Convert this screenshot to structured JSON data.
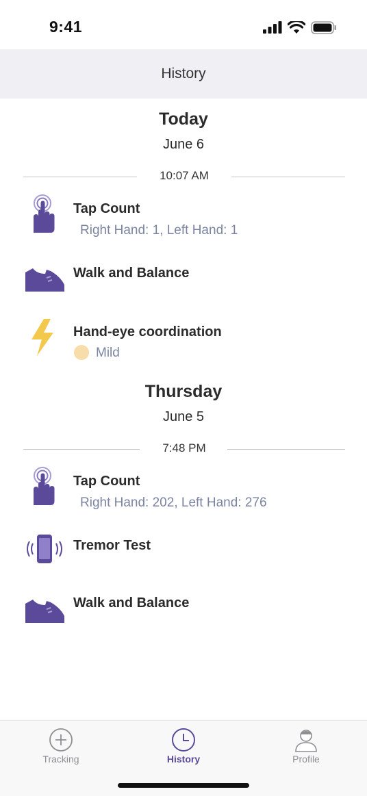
{
  "status": {
    "time": "9:41"
  },
  "header": {
    "title": "History"
  },
  "days": [
    {
      "title": "Today",
      "date": "June 6",
      "time": "10:07 AM",
      "entries": [
        {
          "icon": "tap-hand-icon",
          "title": "Tap Count",
          "detail": "Right Hand: 1, Left Hand: 1"
        },
        {
          "icon": "shoe-icon",
          "title": "Walk and Balance"
        },
        {
          "icon": "lightning-icon",
          "title": "Hand-eye coordination",
          "severity": "Mild",
          "severity_color": "#f7ddaa"
        }
      ]
    },
    {
      "title": "Thursday",
      "date": "June 5",
      "time": "7:48 PM",
      "entries": [
        {
          "icon": "tap-hand-icon",
          "title": "Tap Count",
          "detail": "Right Hand: 202, Left Hand: 276"
        },
        {
          "icon": "vibrating-phone-icon",
          "title": "Tremor Test"
        },
        {
          "icon": "shoe-icon",
          "title": "Walk and Balance"
        }
      ]
    }
  ],
  "tabs": [
    {
      "label": "Tracking",
      "icon": "plus-circle-icon",
      "active": false
    },
    {
      "label": "History",
      "icon": "clock-icon",
      "active": true
    },
    {
      "label": "Profile",
      "icon": "person-icon",
      "active": false
    }
  ],
  "colors": {
    "accent": "#5a4a99",
    "icon_purple": "#5b4a9a",
    "lightning": "#f3c94d",
    "subtitle": "#7b84a0"
  }
}
